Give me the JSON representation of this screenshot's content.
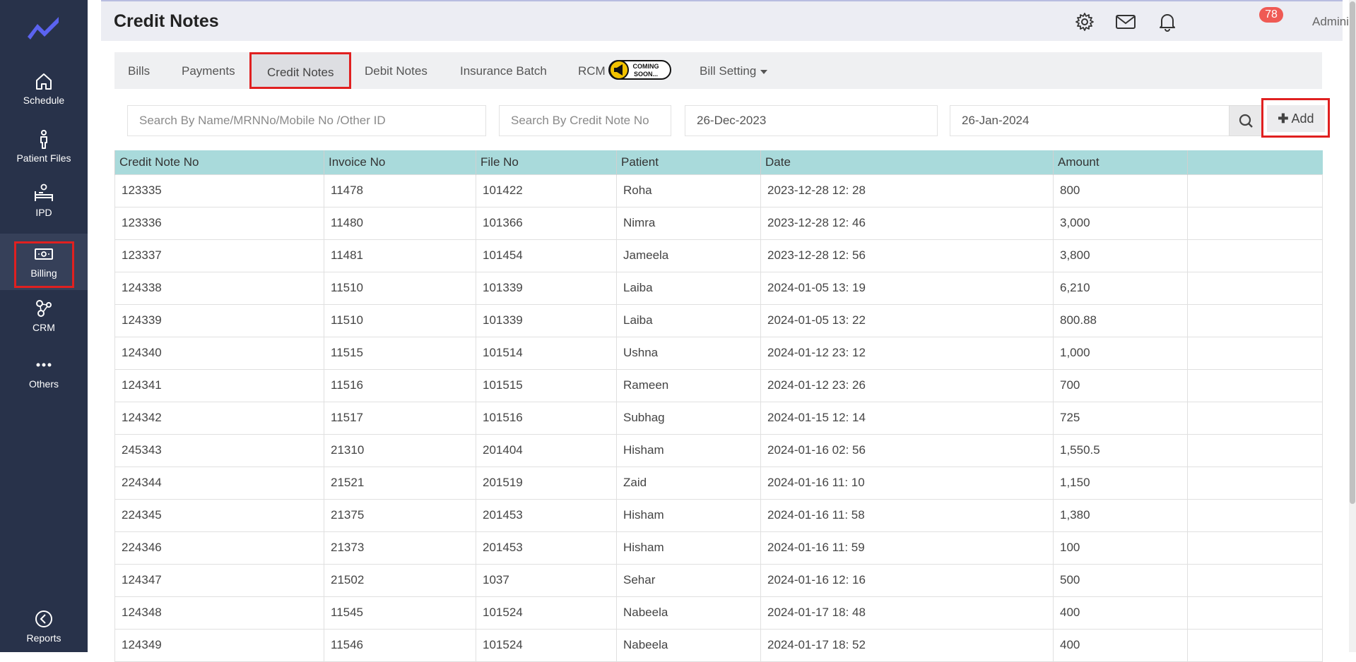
{
  "sidebar": {
    "items": [
      {
        "label": "Schedule",
        "icon": "home-icon"
      },
      {
        "label": "Patient Files",
        "icon": "person-icon"
      },
      {
        "label": "IPD",
        "icon": "bed-icon"
      },
      {
        "label": "Billing",
        "icon": "money-icon"
      },
      {
        "label": "CRM",
        "icon": "crm-icon"
      },
      {
        "label": "Others",
        "icon": "more-icon"
      }
    ],
    "reports_label": "Reports"
  },
  "header": {
    "title": "Credit Notes",
    "notification_count": "78",
    "user_name": "Administrator"
  },
  "tabs": {
    "bills": "Bills",
    "payments": "Payments",
    "credit_notes": "Credit Notes",
    "debit_notes": "Debit Notes",
    "insurance_batch": "Insurance Batch",
    "rcm": "RCM",
    "coming_soon_top": "COMING",
    "coming_soon_bottom": "SOON...",
    "bill_setting": "Bill Setting"
  },
  "search": {
    "name_placeholder": "Search By Name/MRNNo/Mobile No /Other ID",
    "credit_note_placeholder": "Search By Credit Note No",
    "from_date": "26-Dec-2023",
    "to_date": "26-Jan-2024",
    "add_label": "Add"
  },
  "table": {
    "columns": [
      "Credit Note No",
      "Invoice No",
      "File No",
      "Patient",
      "Date",
      "Amount",
      ""
    ],
    "rows": [
      [
        "123335",
        "11478",
        "101422",
        "Roha",
        "2023-12-28 12: 28",
        "800"
      ],
      [
        "123336",
        "11480",
        "101366",
        "Nimra",
        "2023-12-28 12: 46",
        "3,000"
      ],
      [
        "123337",
        "11481",
        "101454",
        "Jameela",
        "2023-12-28 12: 56",
        "3,800"
      ],
      [
        "124338",
        "11510",
        "101339",
        "Laiba",
        "2024-01-05 13: 19",
        "6,210"
      ],
      [
        "124339",
        "11510",
        "101339",
        "Laiba",
        "2024-01-05 13: 22",
        "800.88"
      ],
      [
        "124340",
        "11515",
        "101514",
        "Ushna",
        "2024-01-12 23: 12",
        "1,000"
      ],
      [
        "124341",
        "11516",
        "101515",
        "Rameen",
        "2024-01-12 23: 26",
        "700"
      ],
      [
        "124342",
        "11517",
        "101516",
        "Subhag",
        "2024-01-15 12: 14",
        "725"
      ],
      [
        "245343",
        "21310",
        "201404",
        "Hisham",
        "2024-01-16 02: 56",
        "1,550.5"
      ],
      [
        "224344",
        "21521",
        "201519",
        "Zaid",
        "2024-01-16 11: 10",
        "1,150"
      ],
      [
        "224345",
        "21375",
        "201453",
        "Hisham",
        "2024-01-16 11: 58",
        "1,380"
      ],
      [
        "224346",
        "21373",
        "201453",
        "Hisham",
        "2024-01-16 11: 59",
        "100"
      ],
      [
        "124347",
        "21502",
        "1037",
        "Sehar",
        "2024-01-16 12: 16",
        "500"
      ],
      [
        "124348",
        "11545",
        "101524",
        "Nabeela",
        "2024-01-17 18: 48",
        "400"
      ],
      [
        "124349",
        "11546",
        "101524",
        "Nabeela",
        "2024-01-17 18: 52",
        "400"
      ]
    ]
  },
  "colors": {
    "sidebar_bg": "#28324a",
    "header_bg": "#ecedf3",
    "table_header_bg": "#a9dadb",
    "highlight": "#e02020",
    "badge": "#ef5a54",
    "logo": "#5b63f0"
  }
}
